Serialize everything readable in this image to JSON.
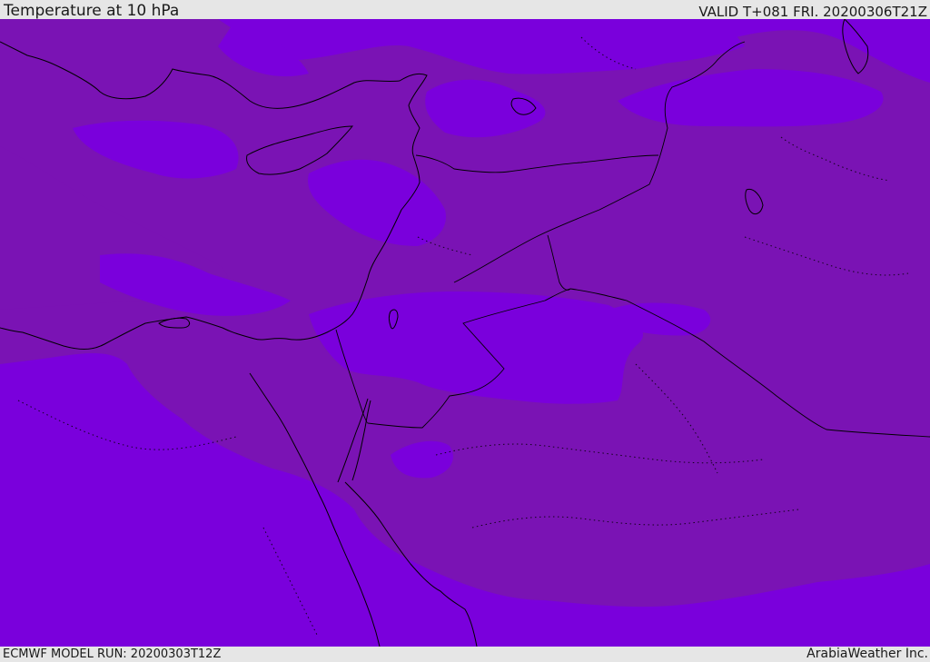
{
  "header": {
    "title": "Temperature at 10 hPa",
    "valid_time": "VALID T+081 FRI. 20200306T21Z"
  },
  "footer": {
    "model_run": "ECMWF MODEL RUN: 20200303T12Z",
    "credit": "ArabiaWeather Inc."
  },
  "map": {
    "colors": {
      "cold_band": "#7a00dc",
      "warm_band": "#7a13b4",
      "coastline": "#000000"
    }
  }
}
